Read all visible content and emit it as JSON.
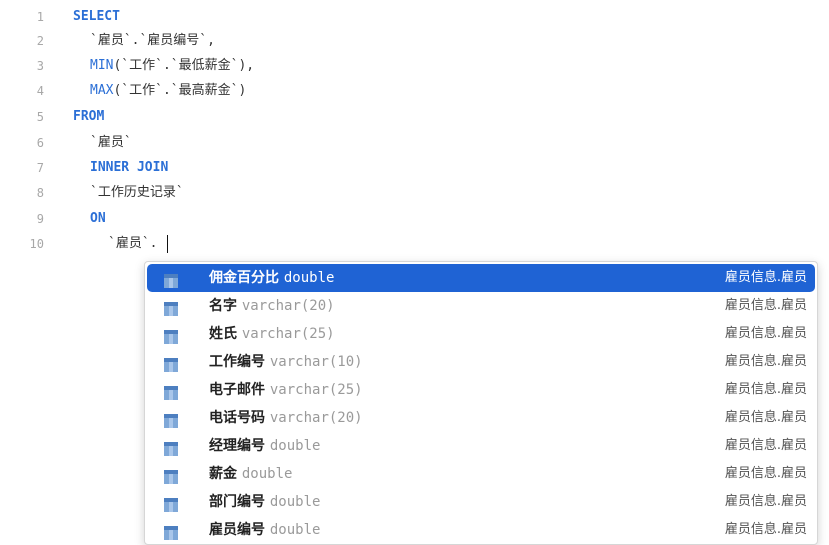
{
  "editor": {
    "line_numbers": [
      "1",
      "2",
      "3",
      "4",
      "5",
      "6",
      "7",
      "8",
      "9",
      "10"
    ],
    "lines": [
      {
        "text": "SELECT"
      },
      {
        "text": "`雇员`.`雇员编号`,"
      },
      {
        "prefix": "MIN",
        "text": "(`工作`.`最低薪金`),"
      },
      {
        "prefix": "MAX",
        "text": "(`工作`.`最高薪金`)"
      },
      {
        "text": "FROM"
      },
      {
        "text": "`雇员`"
      },
      {
        "text": "INNER JOIN"
      },
      {
        "text": "`工作历史记录`"
      },
      {
        "text": "ON"
      },
      {
        "text": "`雇员`."
      }
    ]
  },
  "autocomplete": {
    "items": [
      {
        "name": "佣金百分比",
        "type": "double",
        "source": "雇员信息.雇员",
        "selected": true
      },
      {
        "name": "名字",
        "type": "varchar(20)",
        "source": "雇员信息.雇员"
      },
      {
        "name": "姓氏",
        "type": "varchar(25)",
        "source": "雇员信息.雇员"
      },
      {
        "name": "工作编号",
        "type": "varchar(10)",
        "source": "雇员信息.雇员"
      },
      {
        "name": "电子邮件",
        "type": "varchar(25)",
        "source": "雇员信息.雇员"
      },
      {
        "name": "电话号码",
        "type": "varchar(20)",
        "source": "雇员信息.雇员"
      },
      {
        "name": "经理编号",
        "type": "double",
        "source": "雇员信息.雇员"
      },
      {
        "name": "薪金",
        "type": "double",
        "source": "雇员信息.雇员"
      },
      {
        "name": "部门编号",
        "type": "double",
        "source": "雇员信息.雇员"
      },
      {
        "name": "雇员编号",
        "type": "double",
        "source": "雇员信息.雇员"
      }
    ],
    "icon": "column-icon",
    "colors": {
      "selected_bg": "#1f63d4",
      "keyword": "#2b6fd6"
    }
  }
}
